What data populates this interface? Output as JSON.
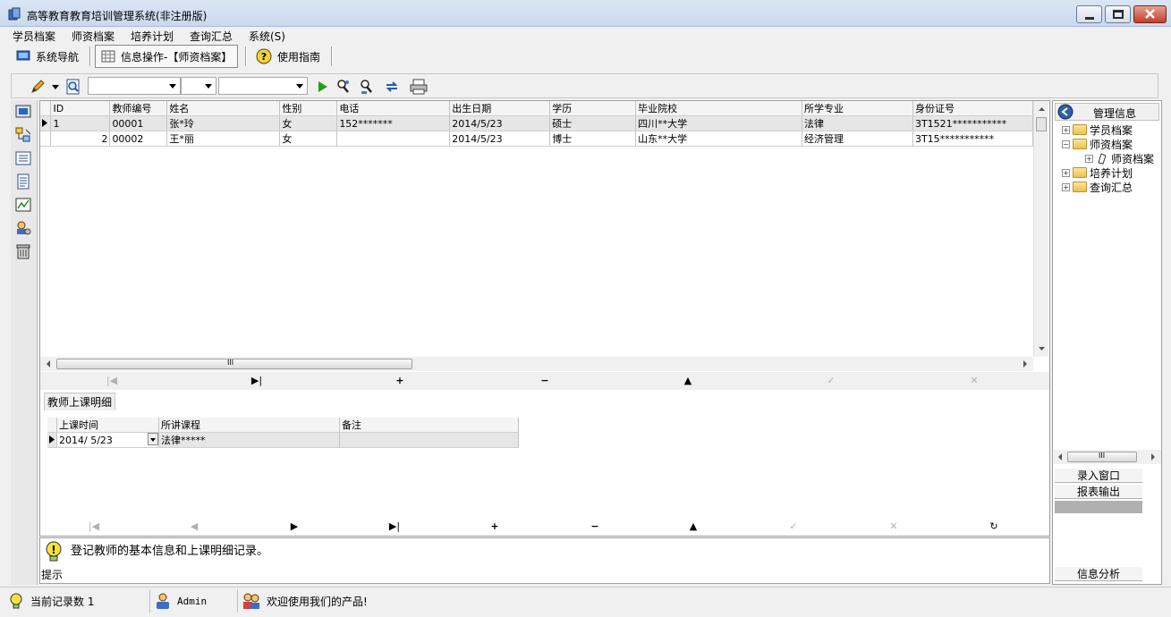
{
  "window": {
    "title": "高等教育教育培训管理系统(非注册版)"
  },
  "menu": [
    "学员档案",
    "师资档案",
    "培养计划",
    "查询汇总",
    "系统(S)"
  ],
  "tabs": {
    "nav": "系统导航",
    "info": "信息操作-【师资档案】",
    "guide": "使用指南"
  },
  "grid": {
    "columns": [
      "ID",
      "教师编号",
      "姓名",
      "性别",
      "电话",
      "出生日期",
      "学历",
      "毕业院校",
      "所学专业",
      "身份证号"
    ],
    "rows": [
      {
        "id": "1",
        "code": "00001",
        "name": "张*玲",
        "gender": "女",
        "phone": "152*******",
        "birth": "2014/5/23",
        "edu": "硕士",
        "school": "四川**大学",
        "major": "法律",
        "idcard": "3T1521***********"
      },
      {
        "id": "2",
        "code": "00002",
        "name": "王*丽",
        "gender": "女",
        "phone": "",
        "birth": "2014/5/23",
        "edu": "博士",
        "school": "山东**大学",
        "major": "经济管理",
        "idcard": "3T15***********"
      }
    ],
    "hscroll_marker": "III"
  },
  "subtab": "教师上课明细",
  "subgrid": {
    "columns": [
      "上课时间",
      "所讲课程",
      "备注"
    ],
    "rows": [
      {
        "date": "2014/ 5/23",
        "course": "法律*****",
        "note": ""
      }
    ]
  },
  "hint": {
    "text": "登记教师的基本信息和上课明细记录。",
    "label": "提示"
  },
  "right_panel": {
    "header": "管理信息",
    "tree": [
      "学员档案",
      "师资档案",
      "师资档案",
      "培养计划",
      "查询汇总"
    ],
    "scroll_marker": "III",
    "buttons": [
      "录入窗口",
      "报表输出",
      "信息分析"
    ]
  },
  "status": {
    "records": "当前记录数 1",
    "user": "Admin",
    "welcome": "欢迎使用我们的产品!"
  },
  "colors": {
    "accent": "#2f5fa8",
    "title_bar": "#c9d9ee",
    "close_button": "#c0402b"
  }
}
